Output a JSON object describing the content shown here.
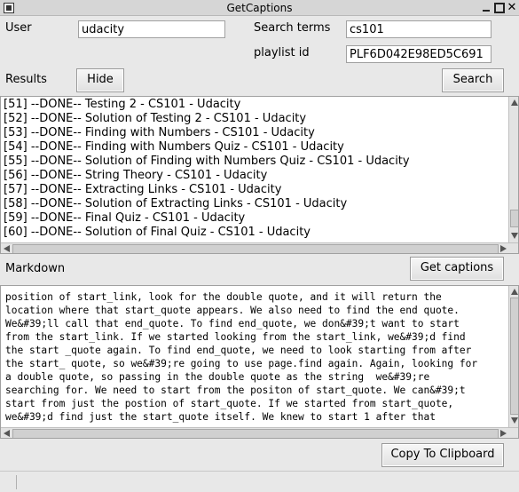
{
  "window": {
    "title": "GetCaptions"
  },
  "user": {
    "label": "User",
    "value": "udacity"
  },
  "search_terms": {
    "label": "Search terms",
    "value": "cs101"
  },
  "playlist": {
    "label": "playlist id",
    "value": "PLF6D042E98ED5C691"
  },
  "results": {
    "label": "Results",
    "hide_label": "Hide",
    "search_label": "Search",
    "items": [
      "[51] --DONE-- Testing 2 - CS101 - Udacity",
      "[52] --DONE-- Solution of Testing 2 - CS101 - Udacity",
      "[53] --DONE-- Finding with Numbers - CS101 - Udacity",
      "[54] --DONE-- Finding with Numbers Quiz - CS101 - Udacity",
      "[55] --DONE-- Solution of Finding with Numbers Quiz - CS101 - Udacity",
      "[56] --DONE-- String Theory - CS101 - Udacity",
      "[57] --DONE-- Extracting Links - CS101 - Udacity",
      "[58] --DONE-- Solution of Extracting Links - CS101 - Udacity",
      "[59] --DONE-- Final Quiz - CS101 - Udacity",
      "[60] --DONE-- Solution of Final Quiz - CS101 - Udacity"
    ]
  },
  "markdown": {
    "label": "Markdown",
    "get_captions_label": "Get captions",
    "copy_label": "Copy To Clipboard",
    "lines": [
      "position of start_link, look for the double quote, and it will return the",
      "location where that start_quote appears. We also need to find the end quote.",
      "We&#39;ll call that end_quote. To find end_quote, we don&#39;t want to start",
      "from the start_link. If we started looking from the start_link, we&#39;d find",
      "the start _quote again. To find end_quote, we need to look starting from after",
      "the start_ quote, so we&#39;re going to use page.find again. Again, looking for",
      "a double quote, so passing in the double quote as the string  we&#39;re",
      "searching for. We need to start from the positon of start_quote. We can&#39;t",
      "start from just the postion of start_quote. If we started from start_quote,",
      "we&#39;d find just the start_quote itself. We knew to start 1 after that"
    ]
  }
}
